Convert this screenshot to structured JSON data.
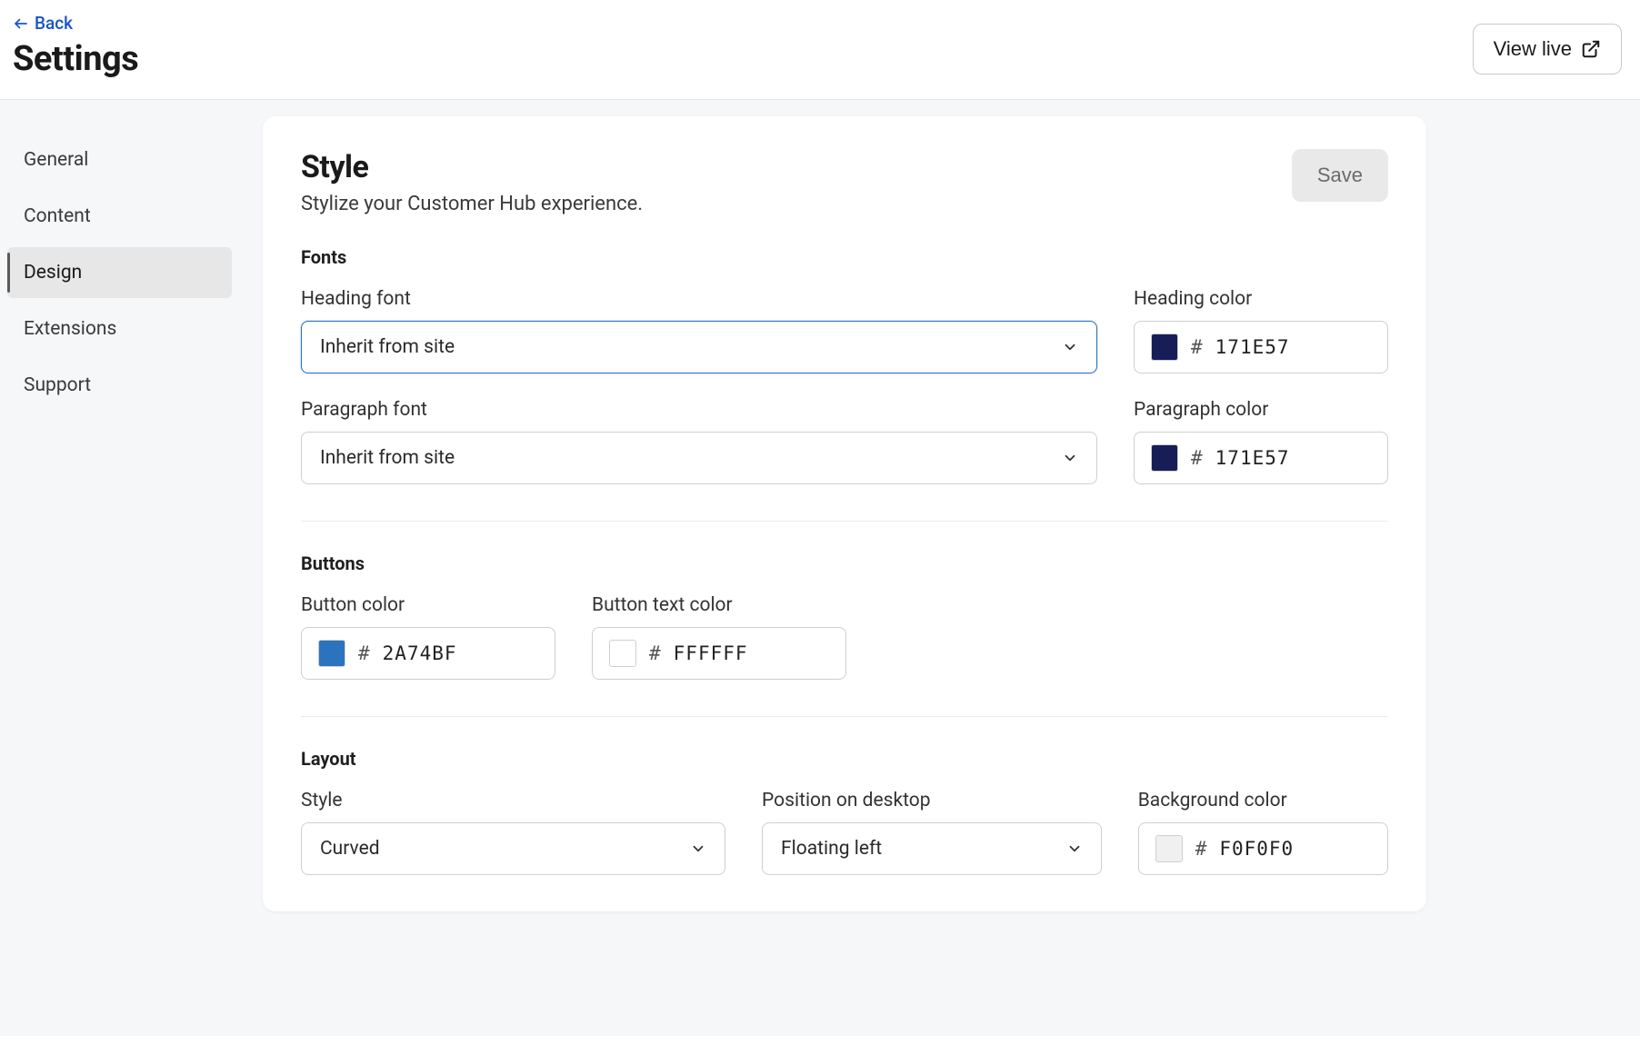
{
  "header": {
    "back_label": "Back",
    "title": "Settings",
    "view_live_label": "View live"
  },
  "sidebar": {
    "items": [
      {
        "label": "General",
        "active": false
      },
      {
        "label": "Content",
        "active": false
      },
      {
        "label": "Design",
        "active": true
      },
      {
        "label": "Extensions",
        "active": false
      },
      {
        "label": "Support",
        "active": false
      }
    ]
  },
  "panel": {
    "title": "Style",
    "subtitle": "Stylize your Customer Hub experience.",
    "save_label": "Save"
  },
  "fonts_section": {
    "heading": "Fonts",
    "heading_font_label": "Heading font",
    "heading_font_value": "Inherit from site",
    "heading_color_label": "Heading color",
    "heading_color_hex": "171E57",
    "paragraph_font_label": "Paragraph font",
    "paragraph_font_value": "Inherit from site",
    "paragraph_color_label": "Paragraph color",
    "paragraph_color_hex": "171E57"
  },
  "buttons_section": {
    "heading": "Buttons",
    "button_color_label": "Button color",
    "button_color_hex": "2A74BF",
    "button_text_color_label": "Button text color",
    "button_text_color_hex": "FFFFFF"
  },
  "layout_section": {
    "heading": "Layout",
    "style_label": "Style",
    "style_value": "Curved",
    "position_label": "Position on desktop",
    "position_value": "Floating left",
    "bg_color_label": "Background color",
    "bg_color_hex": "F0F0F0"
  },
  "glyphs": {
    "hash": "#"
  }
}
